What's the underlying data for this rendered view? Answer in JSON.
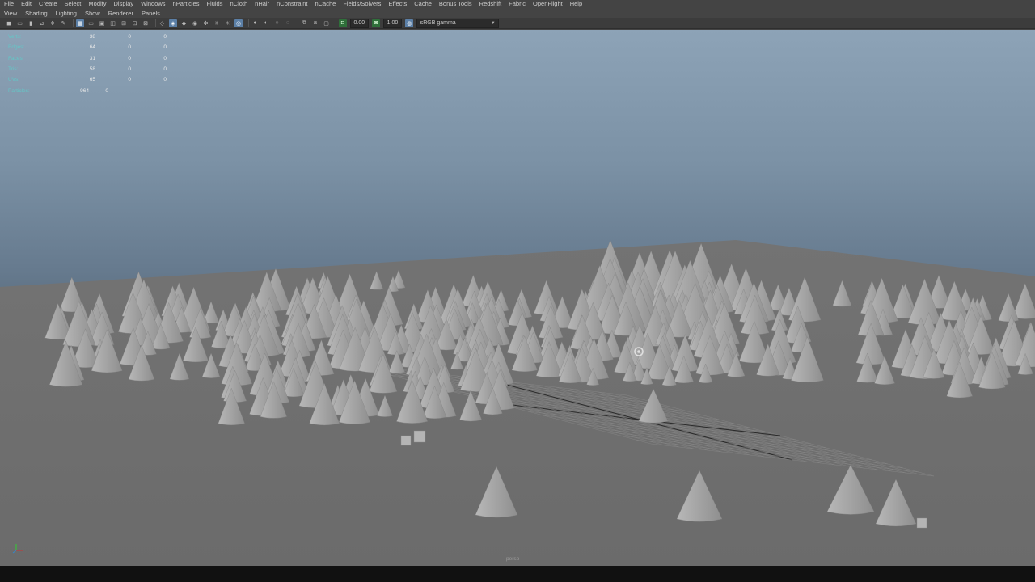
{
  "menus": [
    "File",
    "Edit",
    "Create",
    "Select",
    "Modify",
    "Display",
    "Windows",
    "nParticles",
    "Fluids",
    "nCloth",
    "nHair",
    "nConstraint",
    "nCache",
    "Fields/Solvers",
    "Effects",
    "Cache",
    "Bonus Tools",
    "Redshift",
    "Fabric",
    "OpenFlight",
    "Help"
  ],
  "panel_menus": [
    "View",
    "Shading",
    "Lighting",
    "Show",
    "Renderer",
    "Panels"
  ],
  "toolbar": {
    "exposure_value": "0.00",
    "gamma_value": "1.00",
    "color_space": "sRGB gamma"
  },
  "hud": {
    "rows": [
      {
        "label": "Verts:",
        "a": "38",
        "b": "0",
        "c": "0"
      },
      {
        "label": "Edges:",
        "a": "64",
        "b": "0",
        "c": "0"
      },
      {
        "label": "Faces:",
        "a": "31",
        "b": "0",
        "c": "0"
      },
      {
        "label": "Tris:",
        "a": "58",
        "b": "0",
        "c": "0"
      },
      {
        "label": "UVs:",
        "a": "65",
        "b": "0",
        "c": "0"
      }
    ],
    "particles": {
      "label": "Particles:",
      "a": "964",
      "b": "0"
    }
  },
  "camera_name": "persp",
  "colors": {
    "accent": "#5b7fa6",
    "hud_label": "#63c7c7",
    "ground": "#6d6d6d",
    "sky_top": "#8da3b7"
  }
}
